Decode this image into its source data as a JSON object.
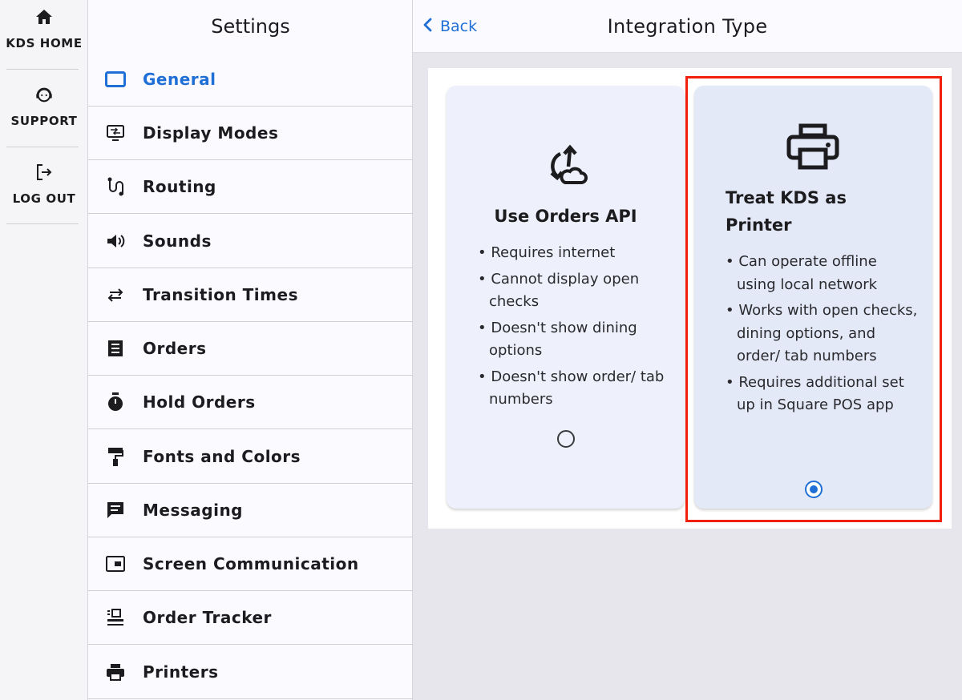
{
  "rail": {
    "items": [
      {
        "label": "KDS HOME",
        "icon": "home-icon"
      },
      {
        "label": "SUPPORT",
        "icon": "headset-icon"
      },
      {
        "label": "LOG OUT",
        "icon": "logout-icon"
      }
    ]
  },
  "settings": {
    "title": "Settings",
    "items": [
      {
        "label": "General",
        "icon": "general-icon",
        "active": true
      },
      {
        "label": "Display Modes",
        "icon": "display-modes-icon"
      },
      {
        "label": "Routing",
        "icon": "routing-icon"
      },
      {
        "label": "Sounds",
        "icon": "speaker-icon"
      },
      {
        "label": "Transition Times",
        "icon": "transition-arrows-icon"
      },
      {
        "label": "Orders",
        "icon": "receipt-icon"
      },
      {
        "label": "Hold Orders",
        "icon": "stopwatch-icon"
      },
      {
        "label": "Fonts and Colors",
        "icon": "paint-roller-icon"
      },
      {
        "label": "Messaging",
        "icon": "message-icon"
      },
      {
        "label": "Screen Communication",
        "icon": "screen-icon"
      },
      {
        "label": "Order Tracker",
        "icon": "order-tracker-icon"
      },
      {
        "label": "Printers",
        "icon": "printer-icon"
      }
    ]
  },
  "header": {
    "back_label": "Back",
    "title": "Integration Type"
  },
  "options": [
    {
      "title": "Use Orders API",
      "icon": "cloud-sync-icon",
      "bullets": [
        "Requires internet",
        "Cannot display open checks",
        "Doesn't show dining options",
        "Doesn't show order/ tab numbers"
      ],
      "selected": false
    },
    {
      "title": "Treat KDS as Printer",
      "icon": "printer-icon",
      "bullets": [
        "Can operate offline using local network",
        "Works with open checks, dining options, and order/ tab numbers",
        "Requires additional set up in Square POS app"
      ],
      "selected": true
    }
  ],
  "colors": {
    "accent": "#1f6fd6",
    "highlight": "#f0200c"
  }
}
